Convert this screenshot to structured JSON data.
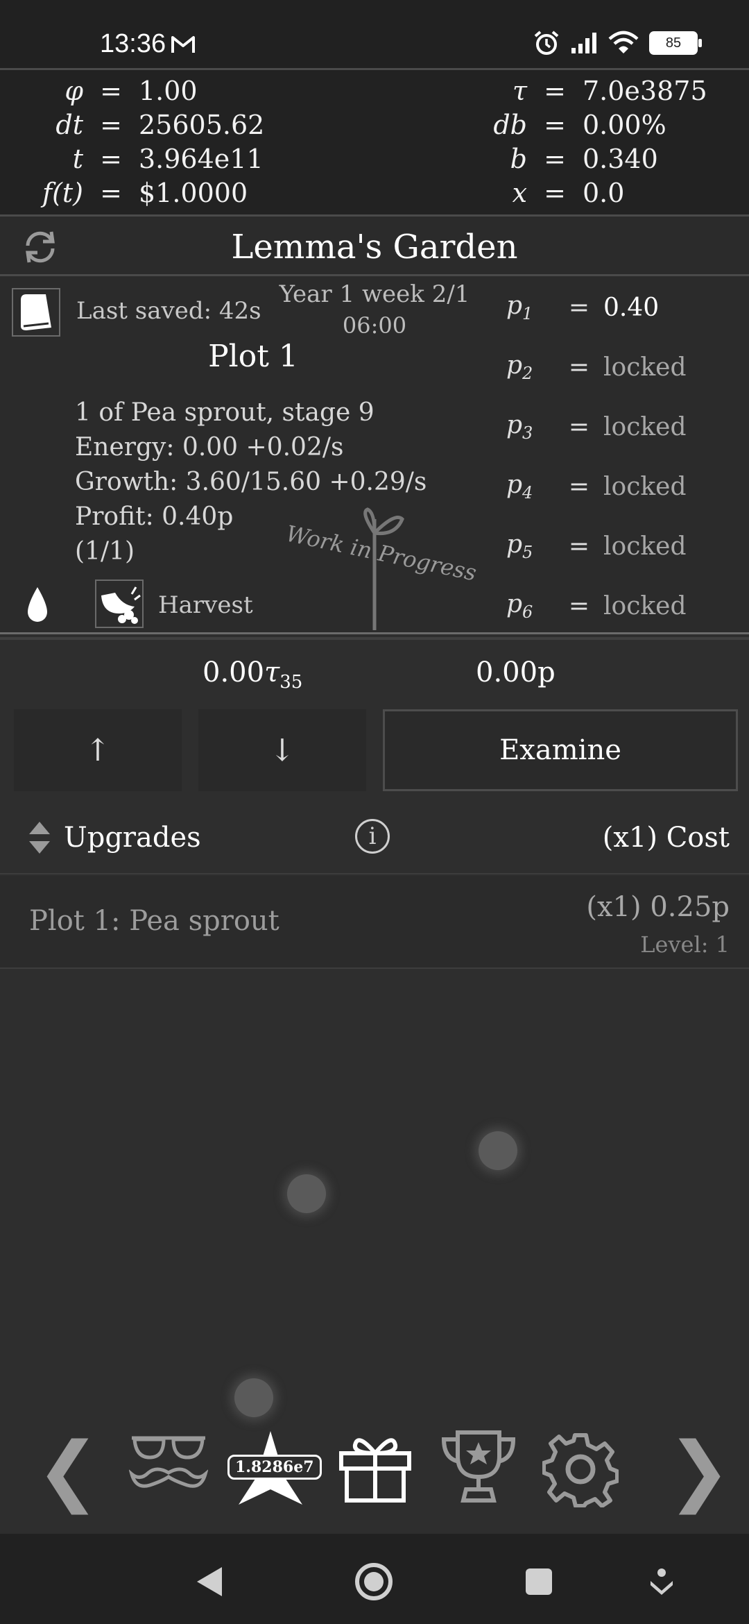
{
  "status_bar": {
    "time": "13:36",
    "battery": "85"
  },
  "variables": [
    {
      "name": "φ",
      "value": "1.00"
    },
    {
      "name": "dt",
      "value": "25605.62"
    },
    {
      "name": "t",
      "value": "3.964e11"
    },
    {
      "name": "f(t)",
      "value": "$1.0000"
    },
    {
      "name": "τ",
      "value": "7.0e3875"
    },
    {
      "name": "db",
      "value": "0.00%"
    },
    {
      "name": "b",
      "value": "0.340"
    },
    {
      "name": "x",
      "value": "0.0"
    }
  ],
  "equals": "=",
  "title": "Lemma's Garden",
  "garden": {
    "last_saved": "Last saved: 42s",
    "date": "Year 1 week 2/1",
    "time": "06:00",
    "plot_title": "Plot 1",
    "info": [
      "1 of Pea sprout, stage 9",
      "Energy: 0.00 +0.02/s",
      "Growth: 3.60/15.60 +0.29/s",
      "Profit: 0.40p",
      "(1/1)"
    ],
    "watermark": "Work in Progress",
    "harvest_label": "Harvest",
    "params": [
      {
        "name": "p",
        "sub": "1",
        "value": "0.40"
      },
      {
        "name": "p",
        "sub": "2",
        "value": "locked"
      },
      {
        "name": "p",
        "sub": "3",
        "value": "locked"
      },
      {
        "name": "p",
        "sub": "4",
        "value": "locked"
      },
      {
        "name": "p",
        "sub": "5",
        "value": "locked"
      },
      {
        "name": "p",
        "sub": "6",
        "value": "locked"
      }
    ]
  },
  "currency": {
    "tau_amount": "0.00",
    "tau_symbol": "τ",
    "tau_sub": "35",
    "p_amount": "0.00p"
  },
  "buttons": {
    "up": "↑",
    "down": "↓",
    "examine": "Examine"
  },
  "upgrades": {
    "header": "Upgrades",
    "info": "i",
    "cost_header": "(x1) Cost",
    "items": [
      {
        "name": "Plot 1: Pea sprout",
        "cost": "(x1) 0.25p",
        "level": "Level: 1"
      }
    ]
  },
  "bottom_nav": {
    "badge": "1.8286e7",
    "prev": "❮",
    "next": "❯"
  }
}
